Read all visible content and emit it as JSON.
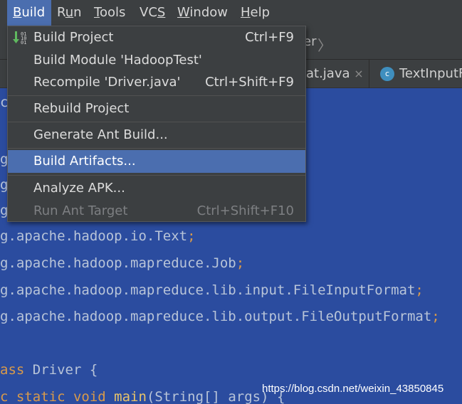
{
  "menubar": {
    "items": [
      {
        "label": "Build",
        "mnemonic": "B",
        "rest": "uild"
      },
      {
        "label": "Run",
        "mnemonic": "u",
        "pre": "R",
        "rest": "n"
      },
      {
        "label": "Tools",
        "mnemonic": "T",
        "rest": "ools"
      },
      {
        "label": "VCS",
        "mnemonic": "S",
        "pre": "VC",
        "rest": ""
      },
      {
        "label": "Window",
        "mnemonic": "W",
        "rest": "indow"
      },
      {
        "label": "Help",
        "mnemonic": "H",
        "rest": "elp"
      }
    ]
  },
  "breadcrumb": {
    "text": "er",
    "separator": "〉"
  },
  "tabs": [
    {
      "label": "at.java",
      "close": "×"
    },
    {
      "label": "TextInputF",
      "icon": "c"
    }
  ],
  "build_menu": {
    "items": [
      {
        "label": "Build Project",
        "shortcut": "Ctrl+F9"
      },
      {
        "label": "Build Module 'HadoopTest'",
        "shortcut": ""
      },
      {
        "label": "Recompile 'Driver.java'",
        "shortcut": "Ctrl+Shift+F9"
      },
      {
        "label": "Rebuild Project",
        "shortcut": ""
      },
      {
        "label": "Generate Ant Build...",
        "shortcut": ""
      },
      {
        "label": "Build Artifacts...",
        "shortcut": "",
        "highlighted": true
      },
      {
        "label": "Analyze APK...",
        "shortcut": ""
      },
      {
        "label": "Run Ant Target",
        "shortcut": "Ctrl+Shift+F10",
        "disabled": true
      }
    ]
  },
  "editor": {
    "lines": [
      {
        "prefix": "c",
        "text": ""
      },
      {
        "prefix": "g",
        "text": ""
      },
      {
        "prefix": "g",
        "text": ""
      },
      {
        "prefix": "g",
        "text": ""
      },
      {
        "text": "g.apache.hadoop.io.Text",
        "semi": ";"
      },
      {
        "text": "g.apache.hadoop.mapreduce.Job",
        "semi": ";"
      },
      {
        "text": "g.apache.hadoop.mapreduce.lib.input.FileInputFormat",
        "semi": ";"
      },
      {
        "text": "g.apache.hadoop.mapreduce.lib.output.FileOutputFormat",
        "semi": ";"
      },
      {
        "kw": "ass",
        "text": " Driver {"
      },
      {
        "kw": "c static void",
        "fn": "main",
        "text": "(String[] args) {"
      }
    ]
  },
  "watermark": "https://blog.csdn.net/weixin_43850845",
  "colors": {
    "accent": "#4b6eaf",
    "editor_bg": "#2b4c9f",
    "panel": "#3c3f41"
  }
}
